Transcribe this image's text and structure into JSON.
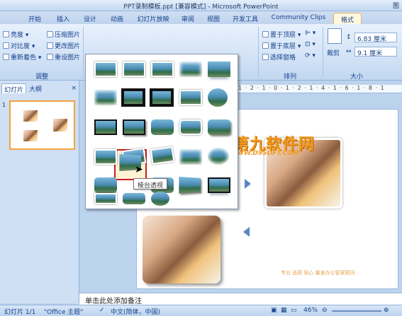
{
  "window": {
    "title": "PPT录制模板.ppt [兼容模式] - Microsoft PowerPoint",
    "controls": "图"
  },
  "tabs": [
    "开始",
    "插入",
    "设计",
    "动画",
    "幻灯片放映",
    "审阅",
    "视图",
    "开发工具",
    "Community Clips",
    "格式"
  ],
  "active_tab": "格式",
  "ribbon": {
    "adjust": {
      "brightness": "亮度",
      "contrast": "对比度",
      "recolor": "重新着色",
      "compress": "压缩图片",
      "change": "更改图片",
      "reset": "重设图片",
      "group_label": "调整"
    },
    "arrange": {
      "bring_front": "置于顶层",
      "send_back": "置于底层",
      "selection_pane": "选择窗格",
      "group_label": "排列"
    },
    "size": {
      "crop": "裁剪",
      "height": "6.83 厘米",
      "width": "9.1 厘米",
      "group_label": "大小"
    }
  },
  "left_panel": {
    "tab_slides": "幻灯片",
    "tab_outline": "大纲",
    "close": "×",
    "thumb_number": "1"
  },
  "gallery": {
    "tooltip": "棱台透视"
  },
  "ruler_text": "1 · 2 · 1 · 0 · 1 · 2 · 1 · 4 · 1 · 6 · 1 · 8 · 1",
  "notes_placeholder": "单击此处添加备注",
  "slide": {
    "caption": "专业  品质  贴心  量身办公管家顾问"
  },
  "watermark": {
    "brand": "第九软件网",
    "url": "WWW.D9SOFT.COM"
  },
  "statusbar": {
    "slide_info": "幻灯片 1/1",
    "theme": "\"Office 主题\"",
    "language": "中文(简体，中国)",
    "zoom": "46%"
  }
}
